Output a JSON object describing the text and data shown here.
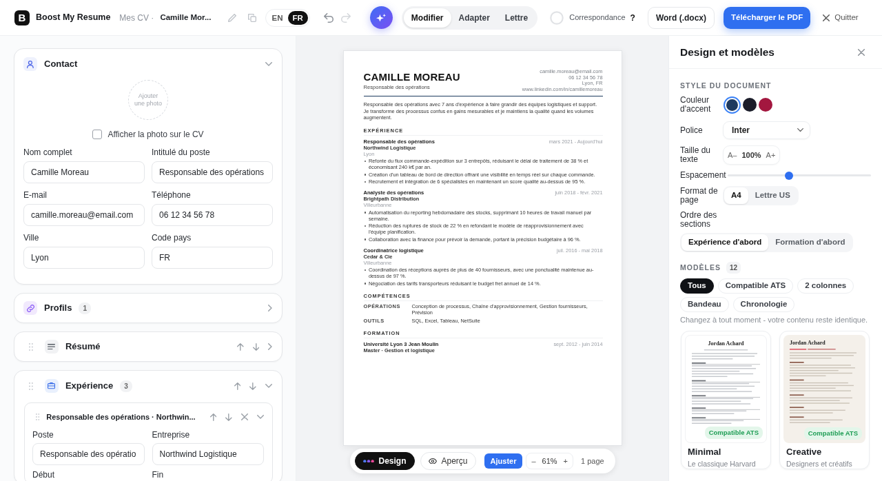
{
  "topbar": {
    "logo": "B",
    "app_name": "Boost My Resume",
    "breadcrumb": "Mes CV ·",
    "document_title": "Camille Mor...",
    "languages": [
      {
        "label": "EN",
        "selected": false
      },
      {
        "label": "FR",
        "selected": true
      }
    ],
    "history": [
      {
        "kind": "undo",
        "disabled": false
      },
      {
        "kind": "redo",
        "disabled": true
      }
    ],
    "modes": [
      {
        "label": "Modifier",
        "selected": true
      },
      {
        "label": "Adapter",
        "selected": false
      },
      {
        "label": "Lettre",
        "selected": false
      }
    ],
    "match": {
      "label": "Correspondance",
      "help": "?"
    },
    "actions": [
      {
        "kind": "outline",
        "label": "Word (.docx)"
      },
      {
        "kind": "primary",
        "label": "Télécharger le PDF"
      },
      {
        "kind": "quit",
        "label": "Quitter"
      }
    ]
  },
  "editor": {
    "sections": [
      {
        "kind": "contact",
        "title": "Contact",
        "movable": false,
        "expanded": true,
        "photo": "Ajouter une photo",
        "show_photo": {
          "label": "Afficher la photo sur le CV",
          "checked": false
        },
        "fields": [
          {
            "label": "Nom complet",
            "value": "Camille Moreau"
          },
          {
            "label": "Intitulé du poste",
            "value": "Responsable des opérations"
          },
          {
            "label": "E-mail",
            "value": "camille.moreau@email.com"
          },
          {
            "label": "Téléphone",
            "value": "06 12 34 56 78"
          },
          {
            "label": "Ville",
            "value": "Lyon"
          },
          {
            "label": "Code pays",
            "value": "FR"
          }
        ]
      },
      {
        "kind": "profiles",
        "title": "Profils",
        "count": "1",
        "movable": false,
        "expanded": false
      },
      {
        "kind": "summary",
        "title": "Résumé",
        "movable": true,
        "expanded": false
      },
      {
        "kind": "experience",
        "title": "Expérience",
        "count": "3",
        "movable": true,
        "expanded": true,
        "items": [
          {
            "title": "Responsable des opérations · Northwin...",
            "expanded": true,
            "fields": [
              {
                "label": "Poste",
                "value": "Responsable des opératio"
              },
              {
                "label": "Entreprise",
                "value": "Northwind Logistique"
              },
              {
                "label": "Début"
              },
              {
                "label": "Fin"
              }
            ]
          }
        ]
      }
    ]
  },
  "preview": {
    "resume": {
      "name": "CAMILLE MOREAU",
      "headline": "Responsable des opérations",
      "contact": [
        "camille.moreau@email.com",
        "06 12 34 56 78",
        "Lyon, FR",
        "www.linkedin.com/in/camillemoreau"
      ],
      "summary": "Responsable des opérations avec 7 ans d'expérience à faire grandir des équipes logistiques et support. Je transforme des processus confus en gains mesurables et je maintiens la qualité quand les volumes augmentent.",
      "sections": [
        {
          "kind": "entries",
          "heading": "EXPÉRIENCE",
          "entries": [
            {
              "title": "Responsable des opérations",
              "organization": "Northwind Logistique",
              "place": "Lyon",
              "dates": "mars 2021 - Aujourd'hui",
              "bullets": [
                "Refonte du flux commande-expédition sur 3 entrepôts, réduisant le délai de traitement de 38 % et économisant 240 k€ par an.",
                "Création d'un tableau de bord de direction offrant une visibilité en temps réel sur chaque commande.",
                "Recrutement et intégration de 6 spécialistes en maintenant un score qualité au-dessus de 95 %."
              ]
            },
            {
              "title": "Analyste des opérations",
              "organization": "Brightpath Distribution",
              "place": "Villeurbanne",
              "dates": "juin 2018 - févr. 2021",
              "bullets": [
                "Automatisation du reporting hebdomadaire des stocks, supprimant 10 heures de travail manuel par semaine.",
                "Réduction des ruptures de stock de 22 % en refondant le modèle de réapprovisionnement avec l'équipe planification.",
                "Collaboration avec la finance pour prévoir la demande, portant la précision budgétaire à 96 %."
              ]
            },
            {
              "title": "Coordinatrice logistique",
              "organization": "Cedar & Cie",
              "place": "Villeurbanne",
              "dates": "juil. 2016 - mai 2018",
              "bullets": [
                "Coordination des réceptions auprès de plus de 40 fournisseurs, avec une ponctualité maintenue au-dessus de 97 %.",
                "Négociation des tarifs transporteurs réduisant le budget fret annuel de 14 %."
              ]
            }
          ]
        },
        {
          "kind": "skills",
          "heading": "COMPÉTENCES",
          "rows": [
            {
              "label": "OPÉRATIONS",
              "value": "Conception de processus, Chaîne d'approvisionnement, Gestion fournisseurs, Prévision"
            },
            {
              "label": "OUTILS",
              "value": "SQL, Excel, Tableau, NetSuite"
            }
          ]
        },
        {
          "kind": "entries",
          "heading": "FORMATION",
          "entries": [
            {
              "title": "Université Lyon 3 Jean Moulin",
              "organization": "Master · Gestion et logistique",
              "dates": "sept. 2012 - juin 2014"
            }
          ]
        }
      ]
    },
    "toolbar": {
      "views": [
        {
          "kind": "design",
          "label": "Design",
          "selected": true
        },
        {
          "kind": "preview",
          "label": "Aperçu",
          "selected": false
        }
      ],
      "fit": "Ajuster",
      "zoom": {
        "decrease": "–",
        "value": "61%",
        "increase": "+"
      },
      "pages": "1 page"
    }
  },
  "design_panel": {
    "title": "Design et modèles",
    "style_heading": "STYLE DU DOCUMENT",
    "accent": {
      "label": "Couleur d'accent",
      "swatches": [
        {
          "color": "#1e3a5f",
          "selected": true
        },
        {
          "color": "#1b1d2a",
          "selected": false
        },
        {
          "color": "#a3173f",
          "selected": false
        }
      ]
    },
    "font": {
      "label": "Police",
      "value": "Inter"
    },
    "text_size": {
      "label": "Taille du texte",
      "decrease": "A–",
      "value": "100%",
      "increase": "A+"
    },
    "spacing": {
      "label": "Espacement",
      "level": 0.43
    },
    "page_format": {
      "label": "Format de page",
      "options": [
        {
          "label": "A4",
          "selected": true
        },
        {
          "label": "Lettre US",
          "selected": false
        }
      ]
    },
    "section_order": {
      "label": "Ordre des sections",
      "options": [
        {
          "label": "Expérience d'abord",
          "selected": true
        },
        {
          "label": "Formation d'abord",
          "selected": false
        }
      ]
    },
    "templates": {
      "heading": "MODÈLES",
      "count": "12",
      "filters": [
        {
          "label": "Tous",
          "selected": true
        },
        {
          "label": "Compatible ATS",
          "selected": false
        },
        {
          "label": "2 colonnes",
          "selected": false
        },
        {
          "label": "Bandeau",
          "selected": false
        },
        {
          "label": "Chronologie",
          "selected": false
        }
      ],
      "note": "Changez à tout moment - votre contenu reste identique.",
      "items": [
        {
          "kind": "classic",
          "name": "Minimal",
          "description": "Le classique Harvard",
          "badge": "Compatible ATS",
          "preview_name": "Jordan Achard"
        },
        {
          "kind": "creative",
          "name": "Creative",
          "description": "Designers et créatifs",
          "badge": "Compatible ATS",
          "preview_name": "Jordan Achard"
        }
      ]
    }
  }
}
